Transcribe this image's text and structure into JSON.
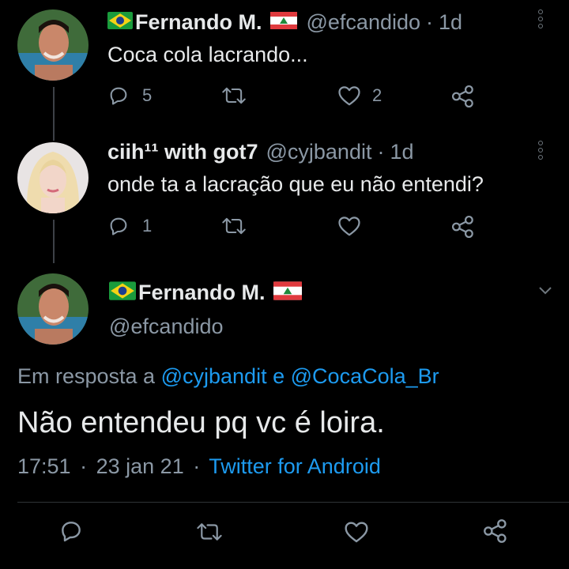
{
  "tweet1": {
    "name": "Fernando M.",
    "handle": "@efcandido",
    "sep": "·",
    "time": "1d",
    "text": "Coca cola lacrando...",
    "reply_count": "5",
    "retweet_count": "",
    "like_count": "2"
  },
  "tweet2": {
    "name": "ciih¹¹ with got7",
    "handle": "@cyjbandit",
    "sep": "·",
    "time": "1d",
    "text": "onde ta a lacração que eu não entendi?",
    "reply_count": "1"
  },
  "main_tweet": {
    "name": "Fernando M.",
    "handle": "@efcandido",
    "reply_prefix": "Em resposta a",
    "reply_user1": "@cyjbandit",
    "reply_and": "e",
    "reply_user2": "@CocaCola_Br",
    "text": "Não entendeu pq vc é loira.",
    "time": "17:51",
    "sep1": "·",
    "date": "23 jan 21",
    "sep2": "·",
    "source": "Twitter for Android"
  },
  "colors": {
    "background": "#000000",
    "link": "#1d9bf0",
    "muted": "#8b98a5",
    "text": "#e7e9ea"
  }
}
